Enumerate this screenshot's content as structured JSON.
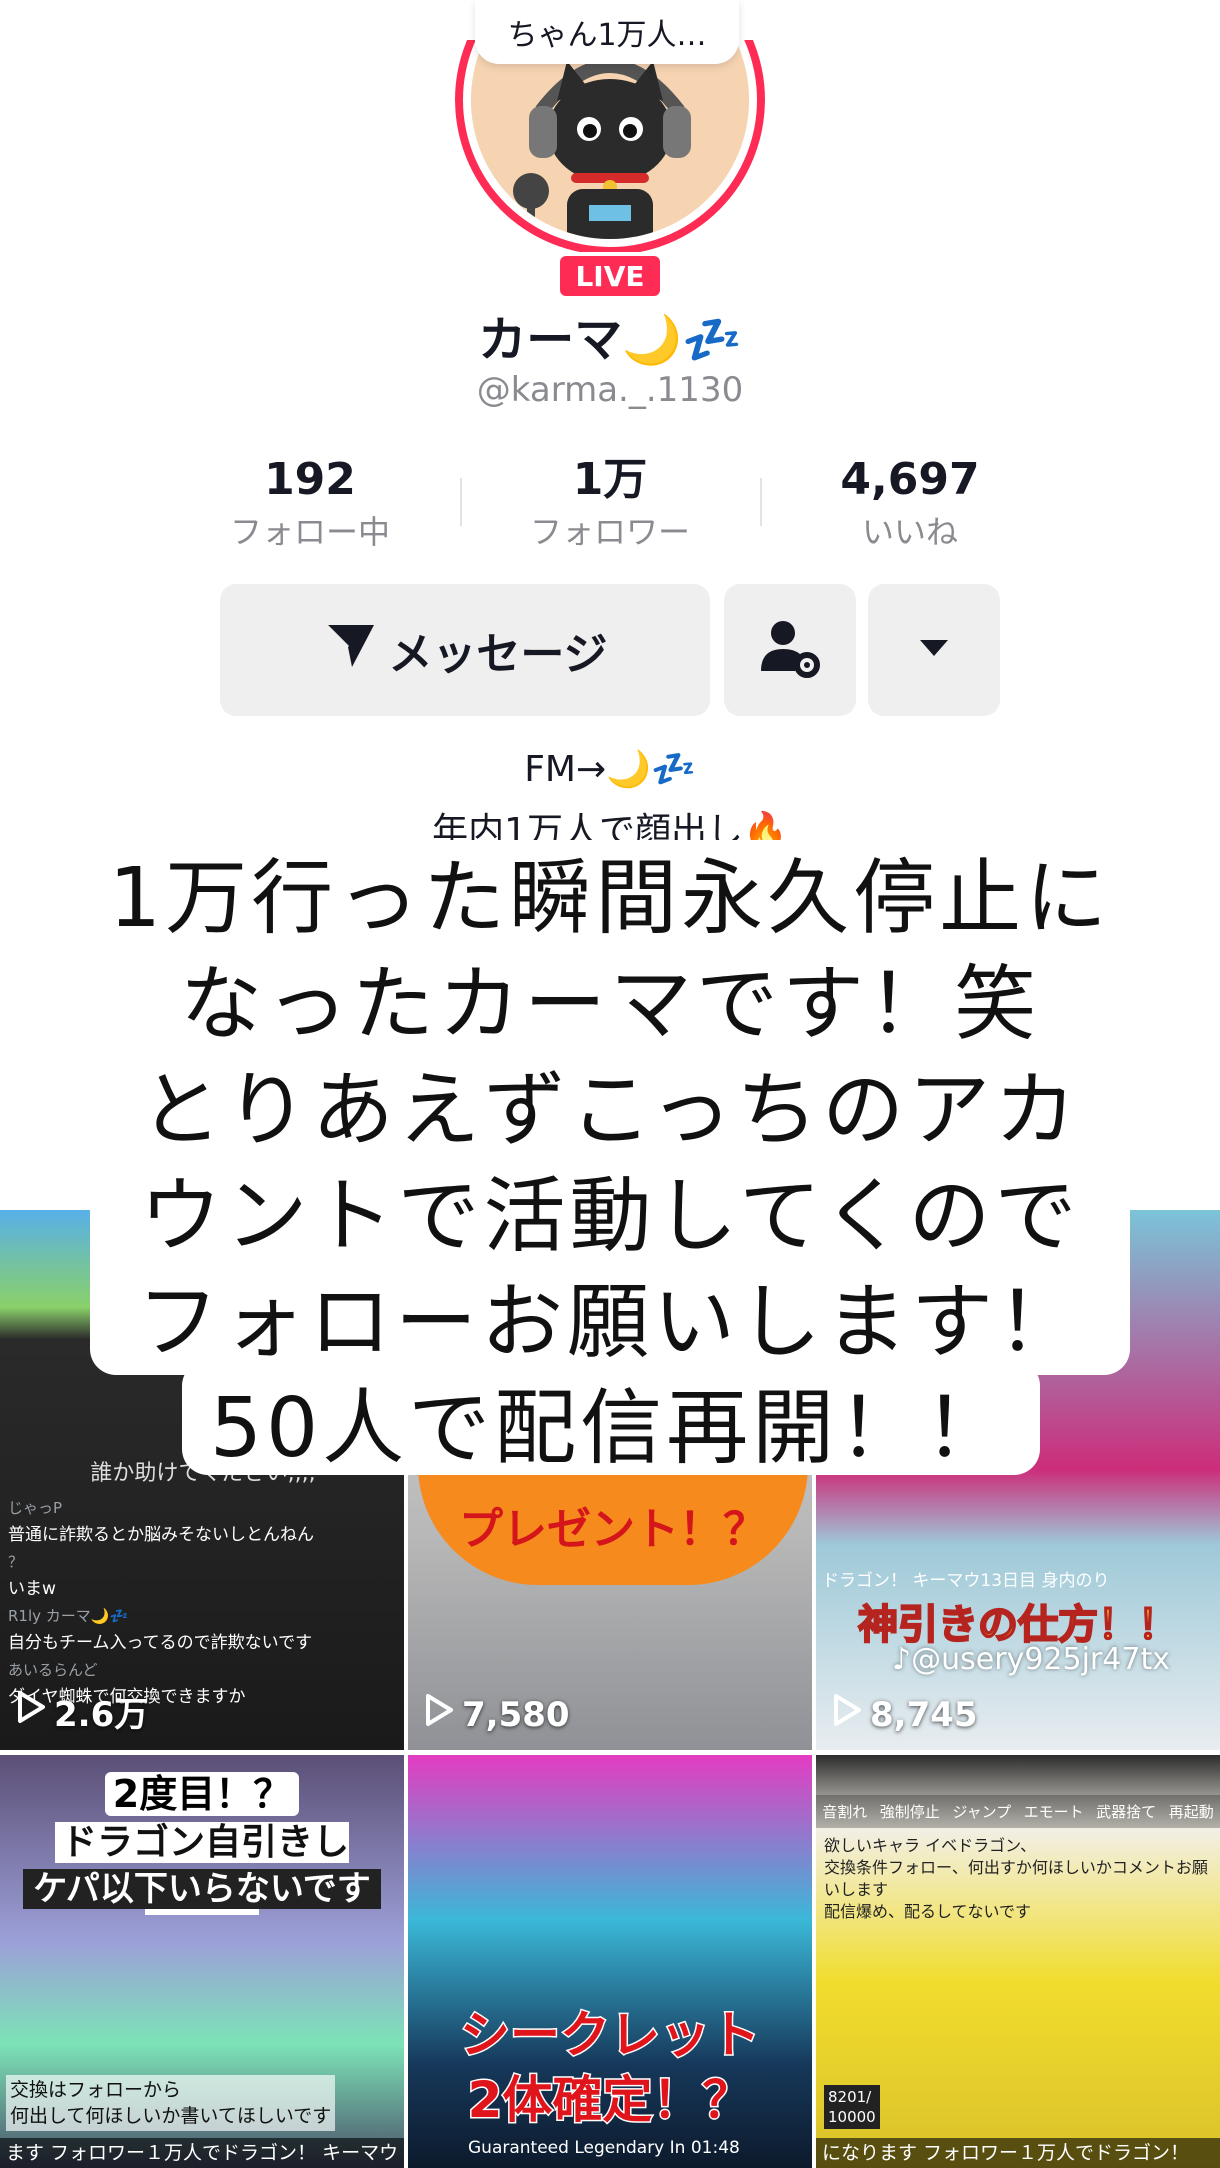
{
  "profile": {
    "bubble_text": "ちゃん1万人…",
    "live_badge": "LIVE",
    "display_name": "カーマ🌙💤",
    "username": "@karma._.1130"
  },
  "stats": [
    {
      "value": "192",
      "label": "フォロー中"
    },
    {
      "value": "1万",
      "label": "フォロワー"
    },
    {
      "value": "4,697",
      "label": "いいね"
    }
  ],
  "actions": {
    "message_label": "メッセージ",
    "add_friend_icon": "person-gear-icon",
    "more_icon": "caret-down-icon"
  },
  "bio": {
    "line1": "FM→🌙💤",
    "line2": "年内1万人で顔出し🔥"
  },
  "overlay_caption": {
    "lines": [
      "1万行った瞬間永久停止に",
      "なったカーマです！笑",
      "とりあえずこっちのアカ",
      "ウントで活動してくので",
      "フォローお願いします！",
      "50人で配信再開！！"
    ]
  },
  "videos": [
    {
      "views": "2.6万",
      "chat_title": "誰か助けてください,,,,",
      "chat": [
        {
          "name": "じゃっP",
          "text": "普通に詐欺るとか脳みそないしとんねん"
        },
        {
          "name": "？",
          "text": "いまw"
        },
        {
          "name": "R1ly カーマ🌙💤",
          "text": "自分もチーム入ってるので詐欺ないです"
        },
        {
          "name": "あいるらんど",
          "text": "ダイヤ蜘蛛で何交換できますか"
        }
      ]
    },
    {
      "views": "7,580",
      "caption": "プレゼント！？"
    },
    {
      "views": "8,745",
      "top_text": "ドラゴン！ キーマウ13日目 身内のり",
      "caption": "神引きの仕方！！",
      "watermark": "♪@usery925jr47tx"
    },
    {
      "caption1": "2度目！？",
      "caption2": "ドラゴン自引きした！！",
      "caption3": "ケパ以下いらないです",
      "foot": "交換はフォローから\n何出して何ほしいか書いてほしいです",
      "bottom": "ます フォロワー１万人でドラゴン！ キーマウ"
    },
    {
      "caption1": "シークレット",
      "caption2": "2体確定！？",
      "foot": "Guaranteed Legendary In 01:48"
    },
    {
      "menu": [
        "音割れ",
        "強制停止",
        "ジャンプ",
        "エモート",
        "武器捨て",
        "再起動"
      ],
      "text": "欲しいキャラ イベドラゴン、\n交換条件フォロー、何出すか何ほしいかコメントお願いします\n配信爆め、配るしてないです",
      "counter": "8201/\n10000",
      "bottom": "になります フォロワー１万人でドラゴン！"
    }
  ],
  "colors": {
    "accent": "#fe2c55",
    "button_bg": "#efefef",
    "muted_text": "#8a8b91"
  }
}
